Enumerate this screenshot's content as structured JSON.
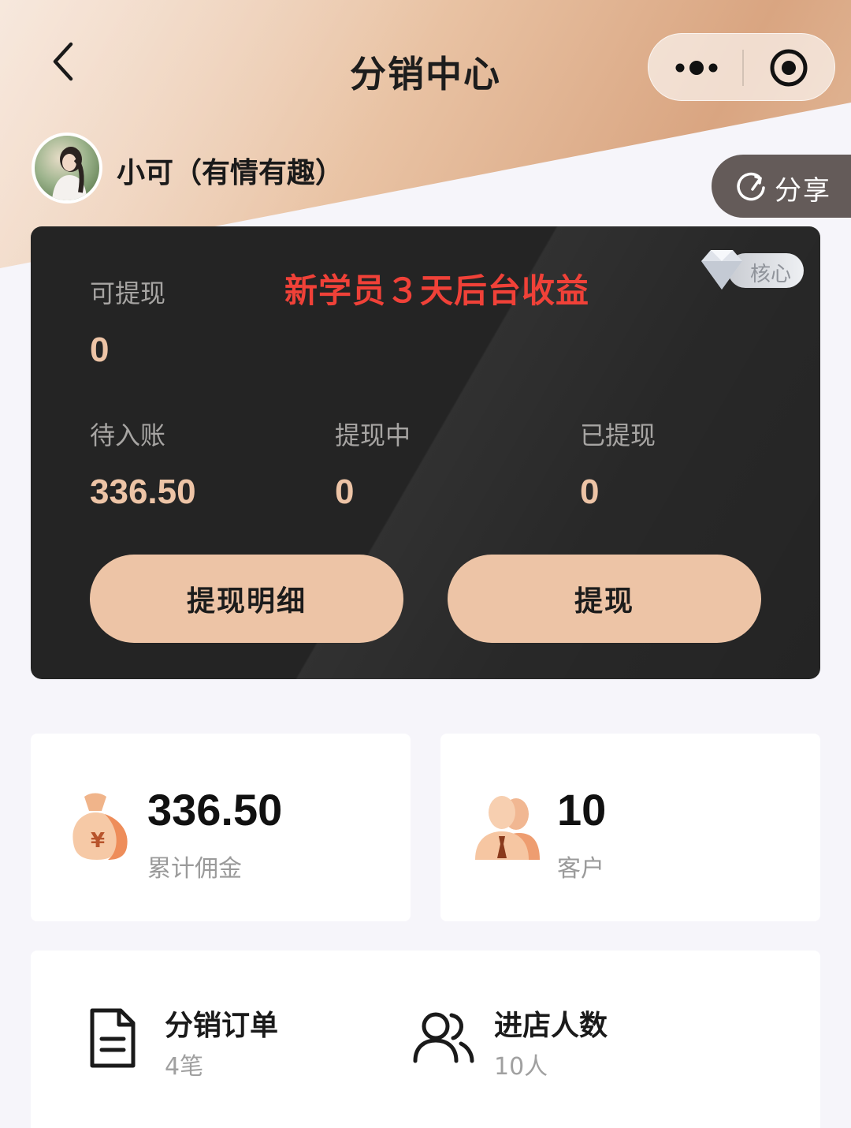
{
  "nav": {
    "title": "分销中心",
    "icons": {
      "back": "chevron-left-icon",
      "more": "more-dots-icon",
      "close": "target-circle-icon"
    }
  },
  "profile": {
    "name": "小可（有情有趣）",
    "share_label": "分享"
  },
  "balance_card": {
    "promo_text": "新学员３天后台收益",
    "badge_label": "核心",
    "withdrawable_label": "可提现",
    "withdrawable_value": "0",
    "pending_label": "待入账",
    "pending_value": "336.50",
    "processing_label": "提现中",
    "processing_value": "0",
    "withdrawn_label": "已提现",
    "withdrawn_value": "0",
    "detail_button": "提现明细",
    "withdraw_button": "提现"
  },
  "stats": {
    "commission_value": "336.50",
    "commission_label": "累计佣金",
    "customers_value": "10",
    "customers_label": "客户"
  },
  "menu": {
    "orders_title": "分销订单",
    "orders_sub": "4笔",
    "visitors_title": "进店人数",
    "visitors_sub": "10人"
  },
  "colors": {
    "accent": "#edc4a6",
    "card_dark": "#242424",
    "promo_red": "#f04138"
  }
}
